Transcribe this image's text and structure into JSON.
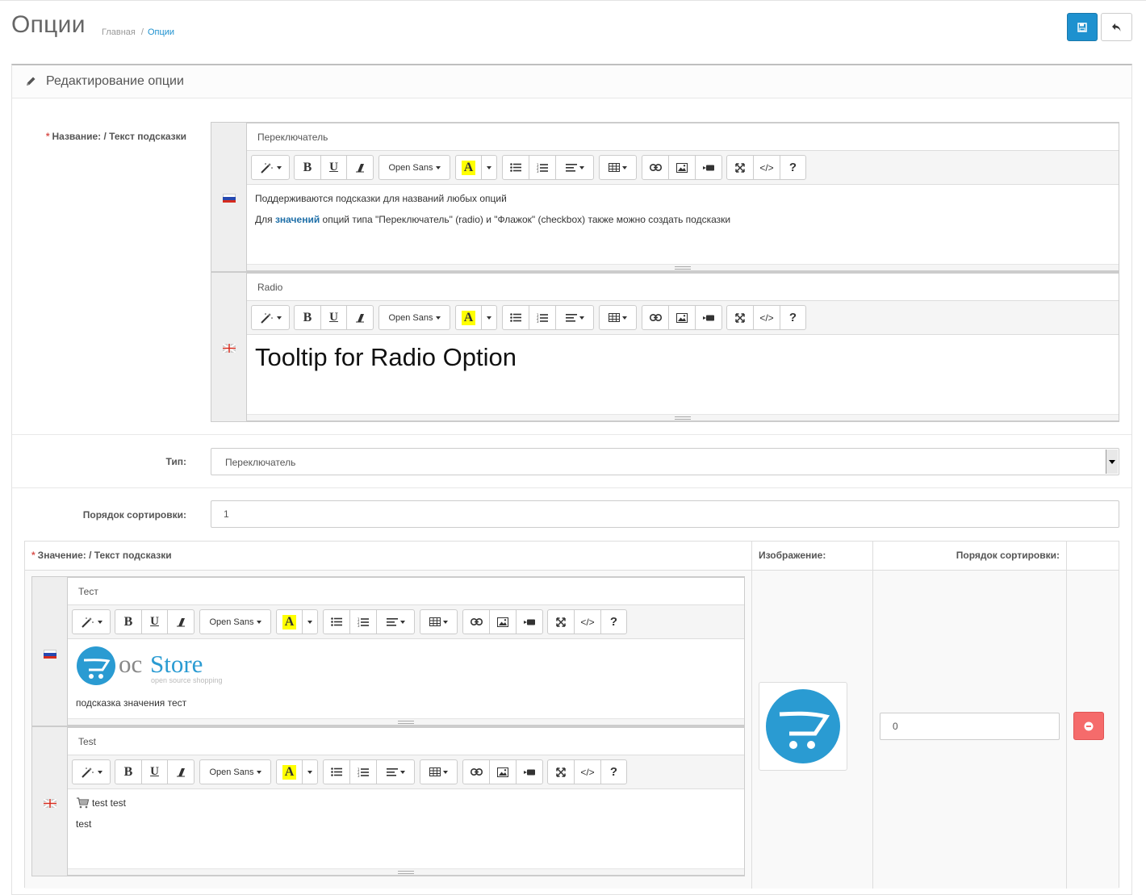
{
  "page": {
    "title": "Опции",
    "breadcrumbs": [
      "Главная",
      "Опции"
    ]
  },
  "panel": {
    "title": "Редактирование опции"
  },
  "form": {
    "name_label": "Название: / Текст подсказки",
    "type_label": "Тип:",
    "type_value": "Переключатель",
    "sort_label": "Порядок сортировки:",
    "sort_value": "1"
  },
  "editor_toolbar": {
    "font": "Open Sans",
    "buttons": [
      "magic-icon",
      "bold-icon",
      "underline-icon",
      "eraser-icon",
      "font-family",
      "color-icon",
      "unordered-list-icon",
      "ordered-list-icon",
      "align-icon",
      "table-icon",
      "link-icon",
      "picture-icon",
      "video-icon",
      "fullscreen-icon",
      "code-icon",
      "help-icon"
    ],
    "highlight_color": "#ffff00"
  },
  "option_names": [
    {
      "lang": "ru",
      "title": "Переключатель",
      "line1": "Поддерживаются подсказки для названий любых опций",
      "line2_pre": "Для ",
      "line2_link": "значений",
      "line2_post": " опций типа \"Переключатель\" (radio) и \"Флажок\" (checkbox) также можно создать подсказки"
    },
    {
      "lang": "en",
      "title": "Radio",
      "text": "Tooltip for Radio Option"
    }
  ],
  "values_table": {
    "col_value": "Значение: / Текст подсказки",
    "col_image": "Изображение:",
    "col_sort": "Порядок сортировки:",
    "row": {
      "editors": [
        {
          "lang": "ru",
          "title": "Тест",
          "logo_oc": "oc",
          "logo_store": "Store",
          "logo_tagline": "open source shopping",
          "text": "подсказка значения тест"
        },
        {
          "lang": "en",
          "title": "Test",
          "line1": "test test",
          "line2": "test"
        }
      ],
      "sort_value": "0"
    }
  },
  "colors": {
    "primary": "#1e91cf",
    "danger": "#f56b6b",
    "required": "#d9534f"
  }
}
